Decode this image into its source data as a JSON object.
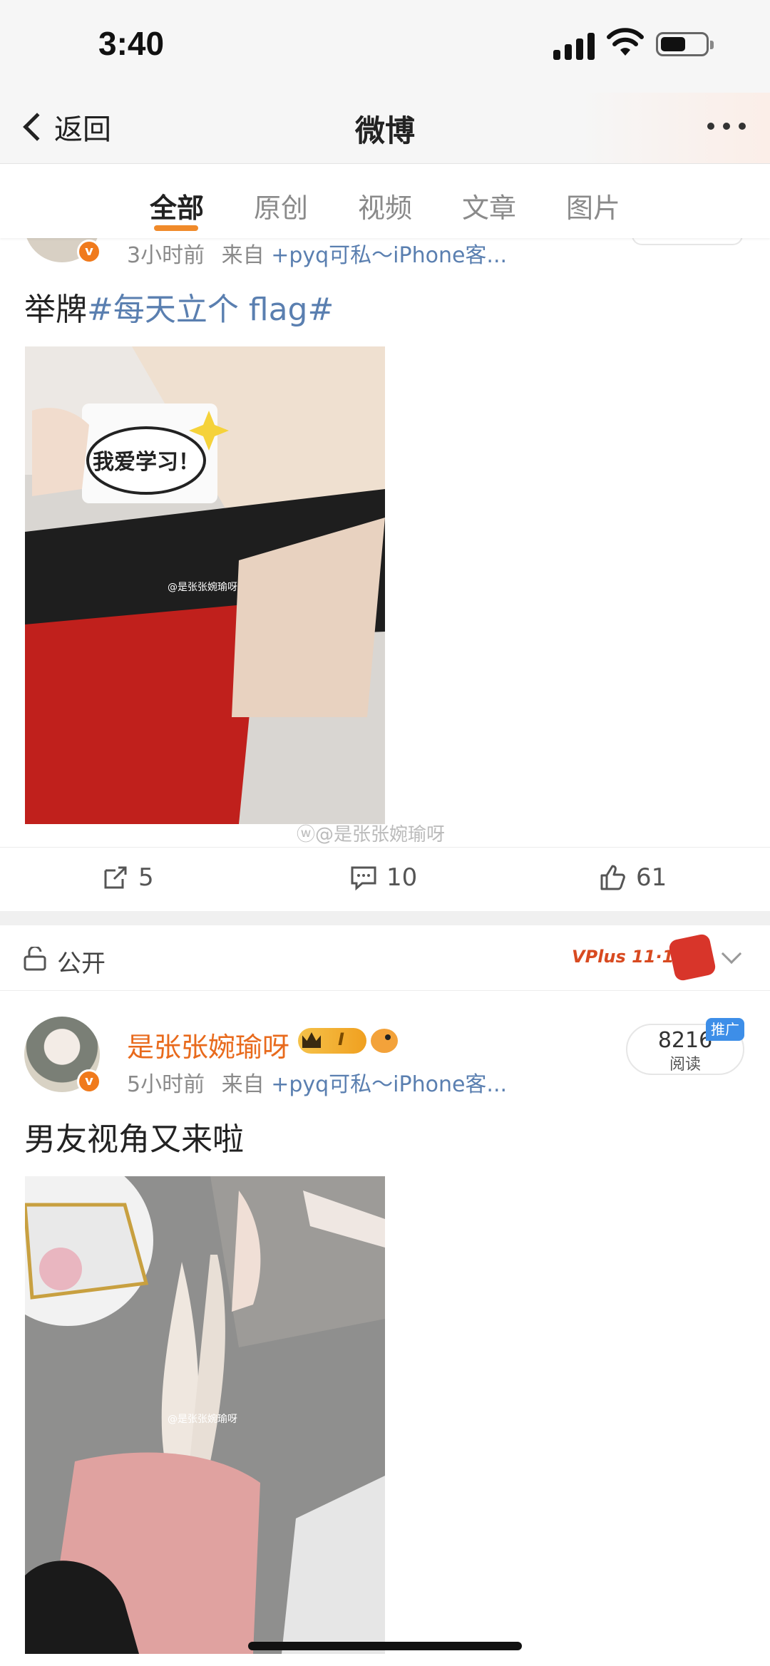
{
  "status_bar": {
    "time": "3:40"
  },
  "nav": {
    "back_label": "返回",
    "title": "微博"
  },
  "tabs": [
    {
      "label": "全部",
      "active": true
    },
    {
      "label": "原创",
      "active": false
    },
    {
      "label": "视频",
      "active": false
    },
    {
      "label": "文章",
      "active": false
    },
    {
      "label": "图片",
      "active": false
    }
  ],
  "post1": {
    "time": "3小时前",
    "from_prefix": "来自",
    "source": "+pyq可私～iPhone客...",
    "text_plain": "举牌",
    "text_tag": "#每天立个 flag#",
    "sign_text": "我爱学习！",
    "image_watermark": "@是张张婉瑜呀",
    "watermark": "@是张张婉瑜呀",
    "actions": {
      "repost": "5",
      "comment": "10",
      "like": "61"
    }
  },
  "privacy": {
    "label": "公开",
    "promo_text": "VPlus 11·11"
  },
  "post2": {
    "username": "是张张婉瑜呀",
    "level_badge": "I",
    "time": "5小时前",
    "from_prefix": "来自",
    "source": "+pyq可私～iPhone客...",
    "read_count": "8216",
    "read_label": "阅读",
    "promo_tag": "推广",
    "text": "男友视角又来啦",
    "image_watermark": "@是张张婉瑜呀"
  },
  "colors": {
    "accent": "#f08a2a",
    "link": "#5a7fb0",
    "username": "#e86a1c",
    "verified": "#f07a1c"
  }
}
